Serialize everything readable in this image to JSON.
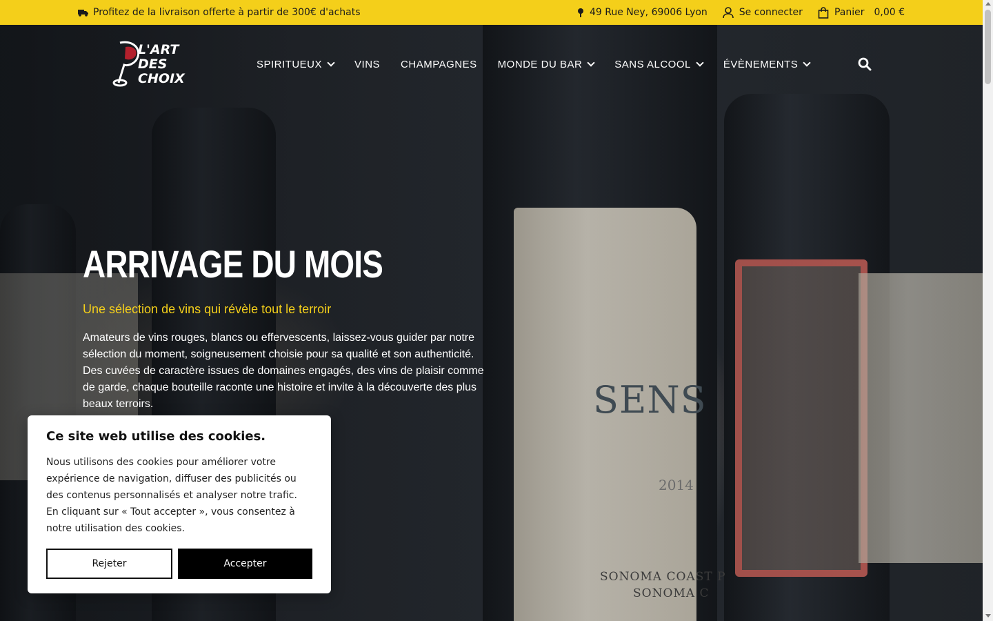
{
  "topbar": {
    "promo": "Profitez de la livraison offerte à partir de 300€ d'achats",
    "address": "49 Rue Ney, 69006 Lyon",
    "login": "Se connecter",
    "cart_label": "Panier",
    "cart_amount": "0,00 €",
    "icons": [
      "truck-icon",
      "map-pin-icon",
      "user-icon",
      "shopping-bag-icon"
    ],
    "color": "#f4cf1a"
  },
  "logo": {
    "line1": "L'ART",
    "line2": "DES",
    "line3": "CHOIX"
  },
  "nav": {
    "items": [
      {
        "label": "SPIRITUEUX",
        "has_dropdown": true
      },
      {
        "label": "VINS",
        "has_dropdown": false
      },
      {
        "label": "CHAMPAGNES",
        "has_dropdown": false
      },
      {
        "label": "MONDE DU BAR",
        "has_dropdown": true
      },
      {
        "label": "SANS ALCOOL",
        "has_dropdown": true
      },
      {
        "label": "ÉVÈNEMENTS",
        "has_dropdown": true
      }
    ],
    "search_icon": "search-icon"
  },
  "hero": {
    "title": "ARRIVAGE DU MOIS",
    "subtitle": "Une sélection de vins qui révèle tout le terroir",
    "description": "Amateurs de vins rouges, blancs ou effervescents, laissez-vous guider par notre sélection du moment, soigneusement choisie pour sa qualité et son authenticité. Des cuvées de caractère issues de domaines engagés, des vins de plaisir comme de garde, chaque bouteille raconte une histoire et invite à la découverte des plus beaux terroirs.",
    "subtitle_color": "#f4cf1a",
    "bottle_label_word": "SENS",
    "bottle_label_year": "2014",
    "bottle_label_line1": "SONOMA COAST P",
    "bottle_label_line2": "SONOMA C"
  },
  "cookie": {
    "title": "Ce site web utilise des cookies.",
    "text": "Nous utilisons des cookies pour améliorer votre expérience de navigation, diffuser des publicités ou des contenus personnalisés et analyser notre trafic. En cliquant sur « Tout accepter », vous consentez à notre utilisation des cookies.",
    "reject_label": "Rejeter",
    "accept_label": "Accepter"
  }
}
